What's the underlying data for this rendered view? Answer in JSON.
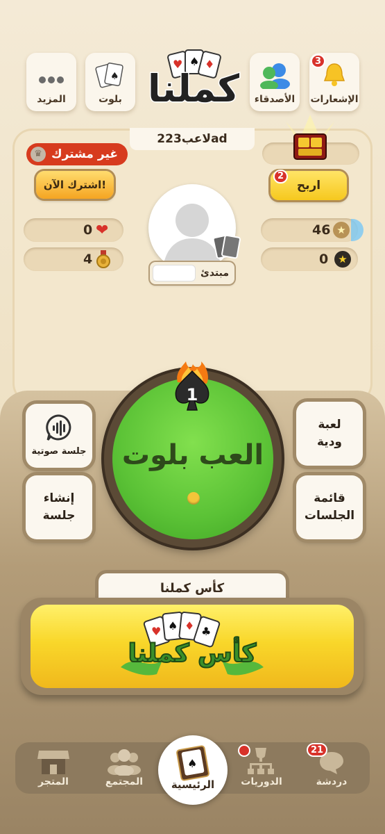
{
  "top_bar": {
    "more_label": "المزيد",
    "baloot_label": "بلوت",
    "logo_text": "كملنا",
    "friends_label": "الأصدقاء",
    "notifications_label": "الإشعارات",
    "notifications_count": "3"
  },
  "profile": {
    "player_name": "لاعب223ad",
    "subscription_status": "غير مشترك",
    "subscribe_button": "اشترك الآن!",
    "win_button": "اربح",
    "win_badge": "2",
    "hearts": "0",
    "medals": "4",
    "stars": "46",
    "black_stars": "0",
    "level_label": "مبتدئ",
    "level_progress": 0
  },
  "main": {
    "play_label": "العب بلوت",
    "rank_number": "1",
    "voice_session": "جلسة صوتية",
    "create_session_line1": "إنشاء",
    "create_session_line2": "جلسة",
    "friendly_game_line1": "لعبة",
    "friendly_game_line2": "ودية",
    "sessions_list_line1": "قائمة",
    "sessions_list_line2": "الجلسات"
  },
  "cup": {
    "title": "كأس كملنا",
    "banner_text": "كأس كملنا"
  },
  "nav": {
    "store": "المتجر",
    "community": "المجتمع",
    "home": "الرئيسية",
    "leagues": "الدوريات",
    "chat": "دردشة",
    "chat_badge": "21"
  },
  "colors": {
    "green": "#5fc43a",
    "yellow": "#f6cf2a",
    "red": "#d8322a",
    "brown": "#8d7a5e"
  }
}
